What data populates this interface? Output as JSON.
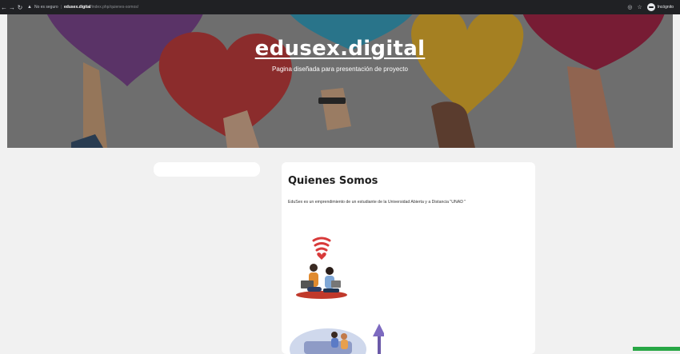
{
  "browser": {
    "security_label": "No es seguro",
    "url_host": "edusex.digital",
    "url_path": "/index.php/quienes-somos/",
    "profile_label": "Incógnito"
  },
  "hero": {
    "title": "edusex.digital",
    "subtitle": "Pagina diseñada para presentación de proyecto"
  },
  "main": {
    "title": "Quienes Somos",
    "text": "EduSex es un emprendimiento de un estudiante de la Universidad Abierta y a Distancia \"UNAD \""
  },
  "colors": {
    "chrome_bg": "#202124",
    "page_bg": "#f1f1f1",
    "card_bg": "#ffffff",
    "heart_purple": "#7a3b8f",
    "heart_red": "#c9302f",
    "heart_crimson": "#a8153c",
    "heart_yellow": "#f2b71f",
    "heart_blue": "#2aa3c7",
    "accent_green": "#28a745"
  }
}
